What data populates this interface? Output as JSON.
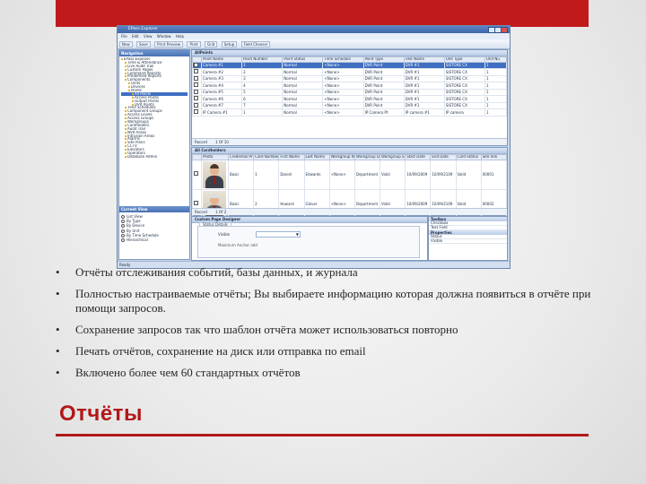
{
  "slide": {
    "title": "Отчёты",
    "bullets": [
      "Отчёты отслеживания событий, базы данных, и журнала",
      "Полностью настраиваемые отчёты; Вы выбираете информацию которая должна появиться в отчёте при помощи запросов.",
      "Сохранение запросов так что шаблон отчёта может использоваться повторно",
      "Печать отчётов, сохранение на диск или отправка по email",
      "Включено более чем 60 стандартных отчётов"
    ],
    "bullet_glyph": "•",
    "accent_color": "#b21818"
  },
  "app": {
    "window_title": "EPass Explorer",
    "menu": [
      "File",
      "Edit",
      "View",
      "Window",
      "Help"
    ],
    "toolbar": [
      "New",
      "Save",
      "Print Preview",
      "Print",
      "Grid",
      "Setup",
      "Field Chooser"
    ],
    "navigation": {
      "title": "Navigation",
      "tree": [
        "EPass Explorer",
        "Time & Attendance",
        "Live Audit Trail",
        "Custom Pages",
        "Command Reports",
        "Predefined Reports",
        "Components",
        "Units",
        "Devices",
        "Points",
        "All Points",
        "Access Points",
        "Output Points",
        "DVR Points",
        "Time Schedules",
        "Component Groups",
        "Access Levels",
        "Access Groups",
        "Workgroups",
        "Cardholders",
        "Audit Trail",
        "NVR Areas",
        "Intrusion Areas",
        "Alarms",
        "Site Plans",
        "CCTV",
        "Elevators",
        "Operators",
        "Database Admin"
      ],
      "selected_index": 10
    },
    "current_view": {
      "title": "Current View",
      "options": [
        "List View",
        "By Type",
        "By Device",
        "By Unit",
        "By Time Schedule",
        "Hierarchical"
      ]
    },
    "points_grid": {
      "title": "AllPoints",
      "columns": [
        "",
        "Point Name",
        "Point Number",
        "Point Status",
        "Time Schedule",
        "Point Type",
        "Unit Name",
        "Unit Type",
        "Unit Nu"
      ],
      "rows": [
        [
          "Camera #1",
          "1",
          "Normal",
          "<None>",
          "DVR Point",
          "DVR #1",
          "SISTORE CX",
          "1"
        ],
        [
          "Camera #2",
          "2",
          "Normal",
          "<None>",
          "DVR Point",
          "DVR #1",
          "SISTORE CX",
          "1"
        ],
        [
          "Camera #3",
          "3",
          "Normal",
          "<None>",
          "DVR Point",
          "DVR #1",
          "SISTORE CX",
          "1"
        ],
        [
          "Camera #4",
          "4",
          "Normal",
          "<None>",
          "DVR Point",
          "DVR #1",
          "SISTORE CX",
          "1"
        ],
        [
          "Camera #5",
          "5",
          "Normal",
          "<None>",
          "DVR Point",
          "DVR #1",
          "SISTORE CX",
          "1"
        ],
        [
          "Camera #6",
          "6",
          "Normal",
          "<None>",
          "DVR Point",
          "DVR #1",
          "SISTORE CX",
          "1"
        ],
        [
          "Camera #7",
          "7",
          "Normal",
          "<None>",
          "DVR Point",
          "DVR #1",
          "SISTORE CX",
          "1"
        ],
        [
          "IP Camera #1",
          "1",
          "Normal",
          "<None>",
          "IP Camera Pt",
          "IP camera #1",
          "IP camera",
          "1"
        ]
      ],
      "selected_row": 0,
      "record_label": "Record",
      "record_value": "1 Of 10"
    },
    "cardholders_grid": {
      "title": "All Cardholders",
      "columns": [
        "",
        "Photo",
        "Credential Profile",
        "Card Number",
        "First Name",
        "Last Name",
        "Workgroup Name",
        "Workgroup Description",
        "Workgroup Status",
        "Start Date",
        "End Date",
        "Card Status",
        "Site Indi"
      ],
      "rows": [
        [
          "Basic",
          "1",
          "Daniel",
          "Edwards",
          "<None>",
          "Department",
          "Valid",
          "10/09/2009",
          "10/09/2109",
          "Valid",
          "00001"
        ],
        [
          "Basic",
          "2",
          "Howard",
          "Glover",
          "<None>",
          "Department",
          "Valid",
          "10/09/2009",
          "10/09/2109",
          "Valid",
          "00002"
        ]
      ],
      "record_label": "Record",
      "record_value": "1 Of 2"
    },
    "designer": {
      "title": "Custom Page Designer",
      "tab": "Status Details",
      "field_label": "Visible",
      "field_hint": "Maximum Anchor add"
    },
    "side_panel": {
      "title": "Toolbox",
      "rows": [
        "Checkbox",
        "Text Field"
      ],
      "props_title": "Properties",
      "props": [
        "Status",
        "Visible"
      ]
    },
    "status_text": "Ready"
  }
}
